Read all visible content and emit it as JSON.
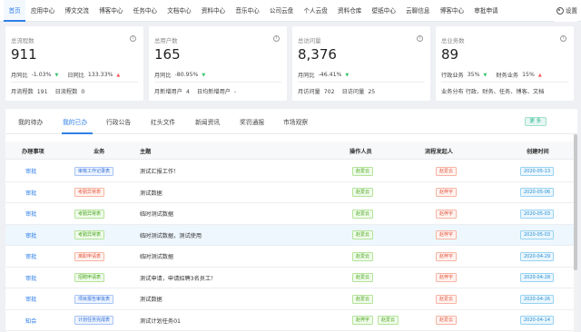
{
  "nav": {
    "items": [
      "首页",
      "应用中心",
      "博文交流",
      "博客中心",
      "任务中心",
      "文档中心",
      "资料中心",
      "音乐中心",
      "公司云盘",
      "个人云盘",
      "资料仓库",
      "壁纸中心",
      "云聊信息",
      "博客中心",
      "审批申请"
    ],
    "settings_label": "设置"
  },
  "cards": [
    {
      "title": "总流程数",
      "value": "911",
      "r1a_label": "月同比",
      "r1a_value": "-1.03%",
      "r1a_dir": "down",
      "r1b_label": "日同比",
      "r1b_value": "133.33%",
      "r1b_dir": "up",
      "r2a_label": "月流程数",
      "r2a_value": "191",
      "r2b_label": "日流程数",
      "r2b_value": "0"
    },
    {
      "title": "总用户数",
      "value": "165",
      "r1a_label": "月同比",
      "r1a_value": "-80.95%",
      "r1a_dir": "down",
      "r2a_label": "月新增用户",
      "r2a_value": "4",
      "r2b_label": "日均新增用户",
      "r2b_value": "-"
    },
    {
      "title": "总访问量",
      "value": "8,376",
      "r1a_label": "月同比",
      "r1a_value": "-46.41%",
      "r1a_dir": "down",
      "r2a_label": "月访问量",
      "r2a_value": "702",
      "r2b_label": "日访问量",
      "r2b_value": "25"
    },
    {
      "title": "总业务数",
      "value": "89",
      "r1a_label": "行政业务",
      "r1a_value": "35%",
      "r1a_dir": "down",
      "r1b_label": "财务业务",
      "r1b_value": "15%",
      "r1b_dir": "up",
      "r2_text": "业务分布  行政、财务、任务、博客、文档"
    }
  ],
  "tabs": [
    "我的待办",
    "我的已办",
    "行政公告",
    "红头文件",
    "新闻资讯",
    "奖罚通报",
    "市场观察"
  ],
  "more_label": "更 多",
  "table": {
    "headers": [
      "办理事项",
      "业务",
      "主题",
      "操作人员",
      "流程发起人",
      "创建时间"
    ],
    "rows": [
      {
        "action": "审批",
        "biz": "审核工作记录表",
        "biz_color": "blue",
        "subject": "测试汇报工作！",
        "operators": [
          "赵爱云"
        ],
        "initiator": "赵爱云",
        "date": "2020-05-13"
      },
      {
        "action": "审批",
        "biz": "考勤异常表",
        "biz_color": "red",
        "subject": "测试数据",
        "operators": [
          "赵爱云"
        ],
        "initiator": "赵梓宇",
        "date": "2020-05-06"
      },
      {
        "action": "审批",
        "biz": "考勤异常表",
        "biz_color": "green",
        "subject": "临时测试数据",
        "operators": [
          "赵爱云"
        ],
        "initiator": "赵梓宇",
        "date": "2020-05-03"
      },
      {
        "action": "审批",
        "biz": "考勤异常表",
        "biz_color": "green",
        "subject": "临时测试数据，测试使用",
        "operators": [
          "赵爱云"
        ],
        "initiator": "赵梓宇",
        "date": "2020-05-03"
      },
      {
        "action": "审批",
        "biz": "离职申请表",
        "biz_color": "red",
        "subject": "临时测试数据",
        "operators": [
          "赵爱云"
        ],
        "initiator": "赵梓宇",
        "date": "2020-04-29"
      },
      {
        "action": "审批",
        "biz": "招聘申请表",
        "biz_color": "green",
        "subject": "测试申请，申请招聘3名员工！",
        "operators": [
          "赵爱云"
        ],
        "initiator": "赵梓宇",
        "date": "2020-04-28"
      },
      {
        "action": "审批",
        "biz": "项目报告审批表",
        "biz_color": "blue",
        "subject": "测试数据",
        "operators": [
          "赵爱云"
        ],
        "initiator": "赵爱云",
        "date": "2020-04-26"
      },
      {
        "action": "知会",
        "biz": "计划任务完成表",
        "biz_color": "blue",
        "subject": "测试计划任务01",
        "operators": [
          "赵梓宇",
          "赵爱云"
        ],
        "initiator": "赵爱云",
        "date": "2020-04-14"
      }
    ],
    "highlight_row": 3
  },
  "colors": {
    "accent": "#2f80e8",
    "up": "#f25959",
    "down": "#36c46b"
  }
}
